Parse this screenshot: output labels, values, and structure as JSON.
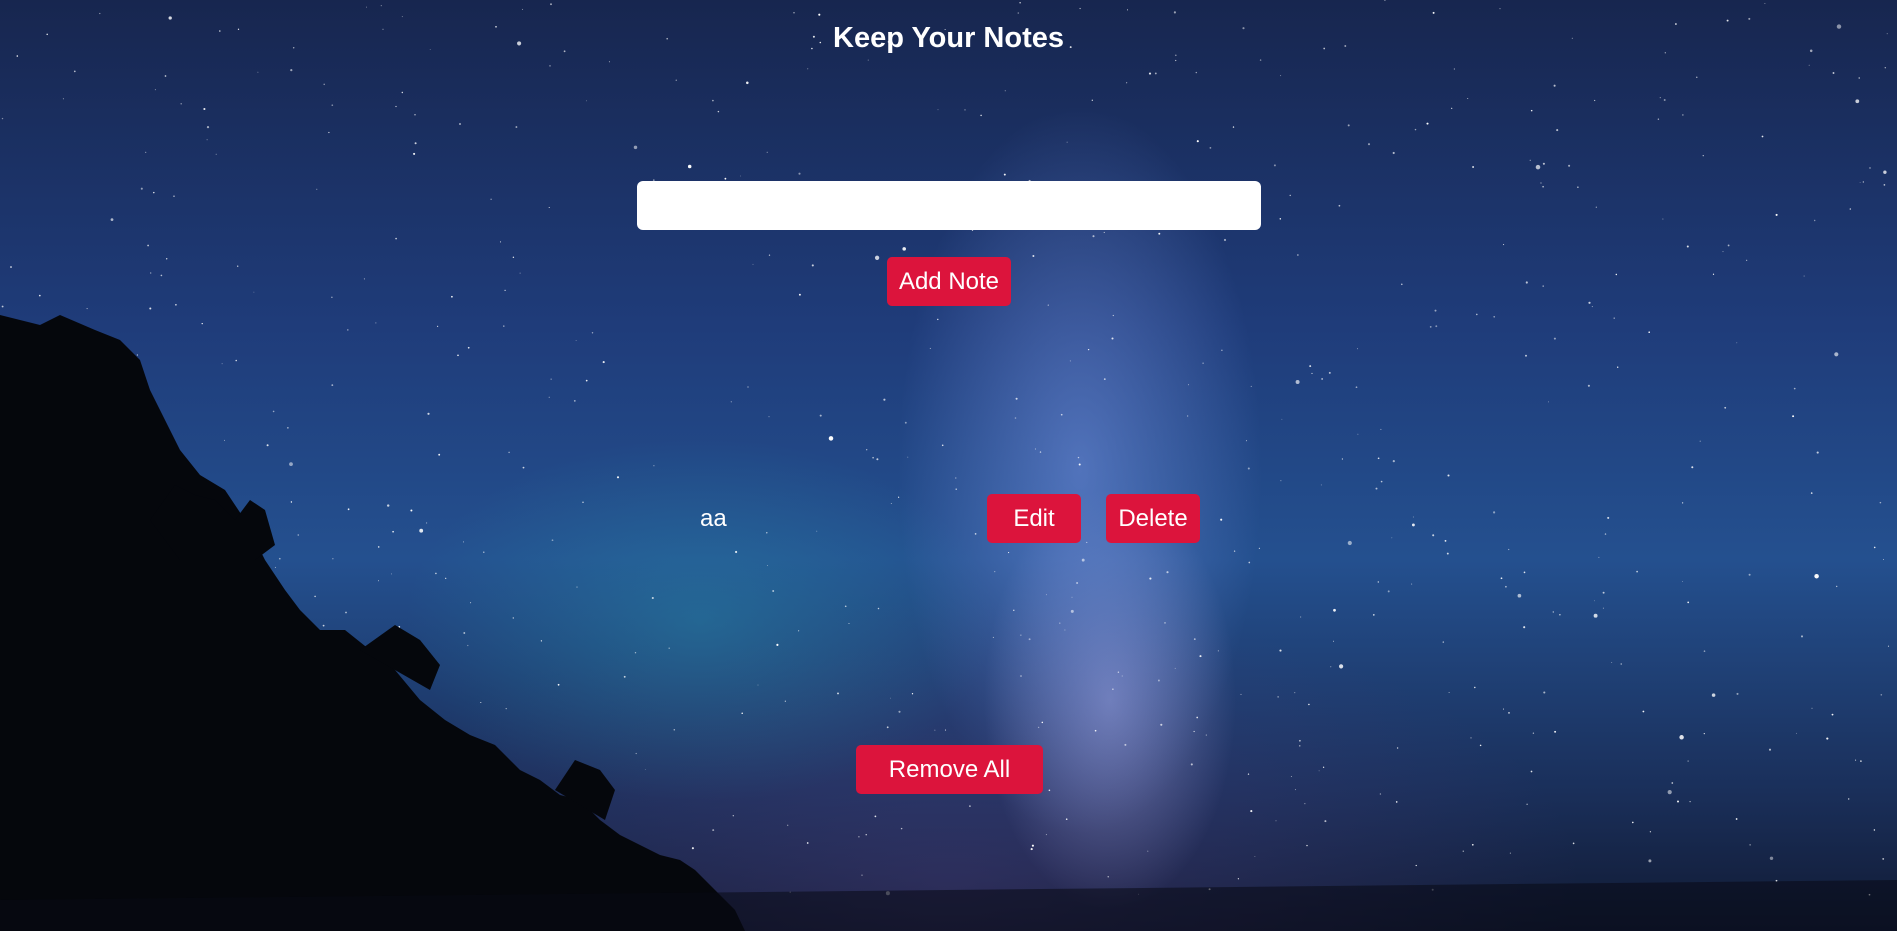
{
  "header": {
    "title": "Keep Your Notes"
  },
  "composer": {
    "input_value": "",
    "add_label": "Add Note"
  },
  "notes": [
    {
      "text": "aa",
      "edit_label": "Edit",
      "delete_label": "Delete"
    }
  ],
  "footer": {
    "remove_all_label": "Remove All"
  },
  "colors": {
    "button": "#dc143c",
    "text": "#ffffff",
    "input_background": "#ffffff"
  }
}
